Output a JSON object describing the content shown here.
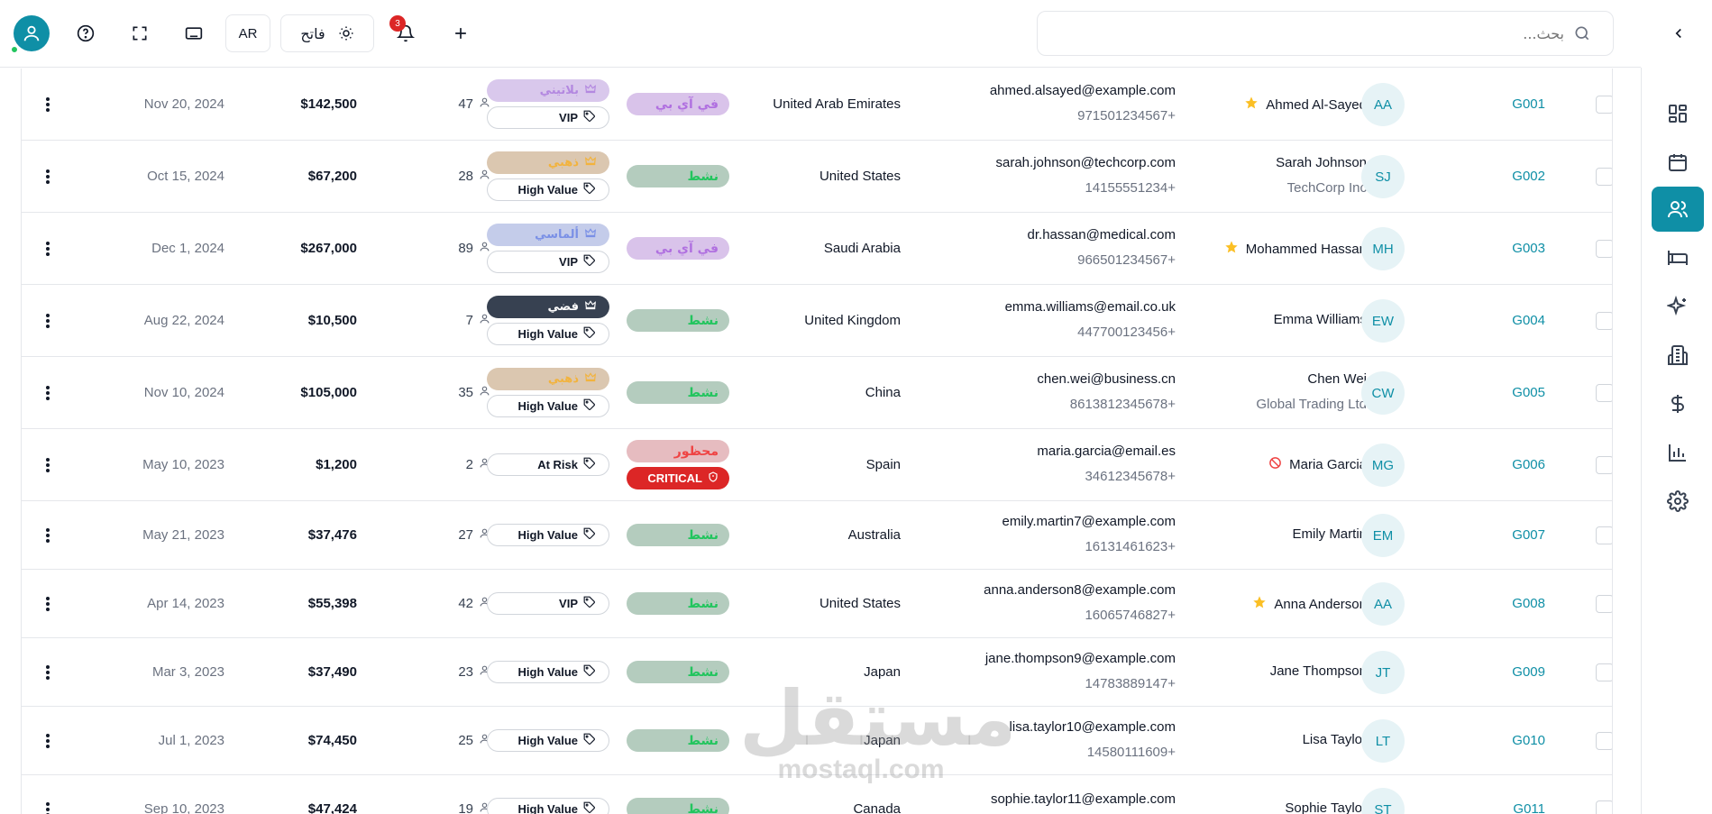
{
  "header": {
    "search_placeholder": "بحث...",
    "language": "AR",
    "theme_label": "فاتح",
    "notification_count": "3"
  },
  "sidebar": {
    "items": [
      {
        "icon": "dashboard-icon",
        "active": false
      },
      {
        "icon": "calendar-icon",
        "active": false
      },
      {
        "icon": "users-icon",
        "active": true
      },
      {
        "icon": "bed-icon",
        "active": false
      },
      {
        "icon": "sparkles-icon",
        "active": false
      },
      {
        "icon": "building-icon",
        "active": false
      },
      {
        "icon": "dollar-icon",
        "active": false
      },
      {
        "icon": "chart-icon",
        "active": false
      },
      {
        "icon": "settings-icon",
        "active": false
      }
    ]
  },
  "colors": {
    "accent": "#0f8fa6",
    "critical": "#dc2626",
    "online": "#22c55e"
  },
  "guests": [
    {
      "code": "G001",
      "initials": "AA",
      "name": "Ahmed Al-Sayed",
      "marker": "star",
      "company": "",
      "email": "ahmed.alsayed@example.com",
      "phone": "971501234567+",
      "country": "United Arab Emirates",
      "status": "في آي بي",
      "status_type": "vip",
      "critical": "",
      "tier": "بلاتيني",
      "tier_type": "platinum",
      "tag": "VIP",
      "orders": "47",
      "amount": "$142,500",
      "date": "Nov 20, 2024"
    },
    {
      "code": "G002",
      "initials": "SJ",
      "name": "Sarah Johnson",
      "marker": "",
      "company": "TechCorp Inc",
      "email": "sarah.johnson@techcorp.com",
      "phone": "14155551234+",
      "country": "United States",
      "status": "نشط",
      "status_type": "active",
      "critical": "",
      "tier": "ذهبي",
      "tier_type": "gold",
      "tag": "High Value",
      "orders": "28",
      "amount": "$67,200",
      "date": "Oct 15, 2024"
    },
    {
      "code": "G003",
      "initials": "MH",
      "name": "Mohammed Hassan",
      "marker": "star",
      "company": "",
      "email": "dr.hassan@medical.com",
      "phone": "966501234567+",
      "country": "Saudi Arabia",
      "status": "في آي بي",
      "status_type": "vip",
      "critical": "",
      "tier": "ألماسي",
      "tier_type": "diamond",
      "tag": "VIP",
      "orders": "89",
      "amount": "$267,000",
      "date": "Dec 1, 2024"
    },
    {
      "code": "G004",
      "initials": "EW",
      "name": "Emma Williams",
      "marker": "",
      "company": "",
      "email": "emma.williams@email.co.uk",
      "phone": "447700123456+",
      "country": "United Kingdom",
      "status": "نشط",
      "status_type": "active",
      "critical": "",
      "tier": "فضي",
      "tier_type": "silver",
      "tag": "High Value",
      "orders": "7",
      "amount": "$10,500",
      "date": "Aug 22, 2024"
    },
    {
      "code": "G005",
      "initials": "CW",
      "name": "Chen Wei",
      "marker": "",
      "company": "Global Trading Ltd",
      "email": "chen.wei@business.cn",
      "phone": "8613812345678+",
      "country": "China",
      "status": "نشط",
      "status_type": "active",
      "critical": "",
      "tier": "ذهبي",
      "tier_type": "gold",
      "tag": "High Value",
      "orders": "35",
      "amount": "$105,000",
      "date": "Nov 10, 2024"
    },
    {
      "code": "G006",
      "initials": "MG",
      "name": "Maria Garcia",
      "marker": "banned",
      "company": "",
      "email": "maria.garcia@email.es",
      "phone": "34612345678+",
      "country": "Spain",
      "status": "محظور",
      "status_type": "banned",
      "critical": "CRITICAL",
      "tier": "",
      "tier_type": "",
      "tag": "At Risk",
      "orders": "2",
      "amount": "$1,200",
      "date": "May 10, 2023"
    },
    {
      "code": "G007",
      "initials": "EM",
      "name": "Emily Martin",
      "marker": "",
      "company": "",
      "email": "emily.martin7@example.com",
      "phone": "16131461623+",
      "country": "Australia",
      "status": "نشط",
      "status_type": "active",
      "critical": "",
      "tier": "",
      "tier_type": "",
      "tag": "High Value",
      "orders": "27",
      "amount": "$37,476",
      "date": "May 21, 2023"
    },
    {
      "code": "G008",
      "initials": "AA",
      "name": "Anna Anderson",
      "marker": "star",
      "company": "",
      "email": "anna.anderson8@example.com",
      "phone": "16065746827+",
      "country": "United States",
      "status": "نشط",
      "status_type": "active",
      "critical": "",
      "tier": "",
      "tier_type": "",
      "tag": "VIP",
      "orders": "42",
      "amount": "$55,398",
      "date": "Apr 14, 2023"
    },
    {
      "code": "G009",
      "initials": "JT",
      "name": "Jane Thompson",
      "marker": "",
      "company": "",
      "email": "jane.thompson9@example.com",
      "phone": "14783889147+",
      "country": "Japan",
      "status": "نشط",
      "status_type": "active",
      "critical": "",
      "tier": "",
      "tier_type": "",
      "tag": "High Value",
      "orders": "23",
      "amount": "$37,490",
      "date": "Mar 3, 2023"
    },
    {
      "code": "G010",
      "initials": "LT",
      "name": "Lisa Taylor",
      "marker": "",
      "company": "",
      "email": "lisa.taylor10@example.com",
      "phone": "14580111609+",
      "country": "Japan",
      "status": "نشط",
      "status_type": "active",
      "critical": "",
      "tier": "",
      "tier_type": "",
      "tag": "High Value",
      "orders": "25",
      "amount": "$74,450",
      "date": "Jul 1, 2023"
    },
    {
      "code": "G011",
      "initials": "ST",
      "name": "Sophie Taylor",
      "marker": "",
      "company": "",
      "email": "sophie.taylor11@example.com",
      "phone": "",
      "country": "Canada",
      "status": "نشط",
      "status_type": "active",
      "critical": "",
      "tier": "",
      "tier_type": "",
      "tag": "High Value",
      "orders": "19",
      "amount": "$47,424",
      "date": "Sep 10, 2023"
    }
  ],
  "watermark": {
    "arabic": "مستقل",
    "latin": "mostaql.com"
  }
}
